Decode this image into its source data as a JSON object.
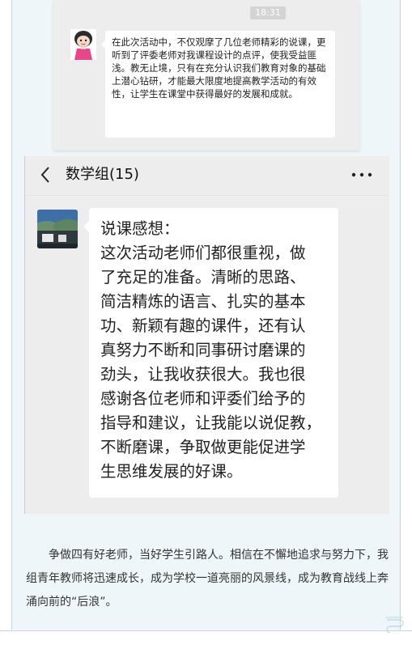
{
  "screenshot1": {
    "time": "18:31",
    "message": "在此次活动中，不仅观摩了几位老师精彩的说课，更听到了评委老师对我课程设计的点评，使我受益匪浅。教无止境，只有在充分认识我们教育对象的基础上潜心钻研，才能最大限度地提高教学活动的有效性，让学生在课堂中获得最好的发展和成就。"
  },
  "screenshot2": {
    "chat_title": "数学组(15)",
    "message_lines": [
      "说课感想：",
      "这次活动老师们都很重视，做",
      "了充足的准备。清晰的思路、",
      "简洁精炼的语言、扎实的基本",
      "功、新颖有趣的课件，还有认",
      "真努力不断和同事研讨磨课的",
      "劲头，让我收获很大。我也很",
      "感谢各位老师和评委们给予的",
      "指导和建议，让我能以说促教，",
      "不断磨课，争取做更能促进学",
      "生思维发展的好课。"
    ]
  },
  "paragraph": "争做四有好老师，当好学生引路人。相信在不懈地追求与努力下，我组青年教师将迅速成长，成为学校一道亮丽的风景线，成为教育战线上奔涌向前的“后浪”。",
  "icons": [
    "back-icon",
    "more-icon",
    "cartoon-avatar",
    "photo-avatar"
  ],
  "colors": {
    "frame_bg": "#eef6fa",
    "frame_border": "#b9d6e2",
    "chat_bg": "#ededed",
    "bubble": "#ffffff"
  }
}
